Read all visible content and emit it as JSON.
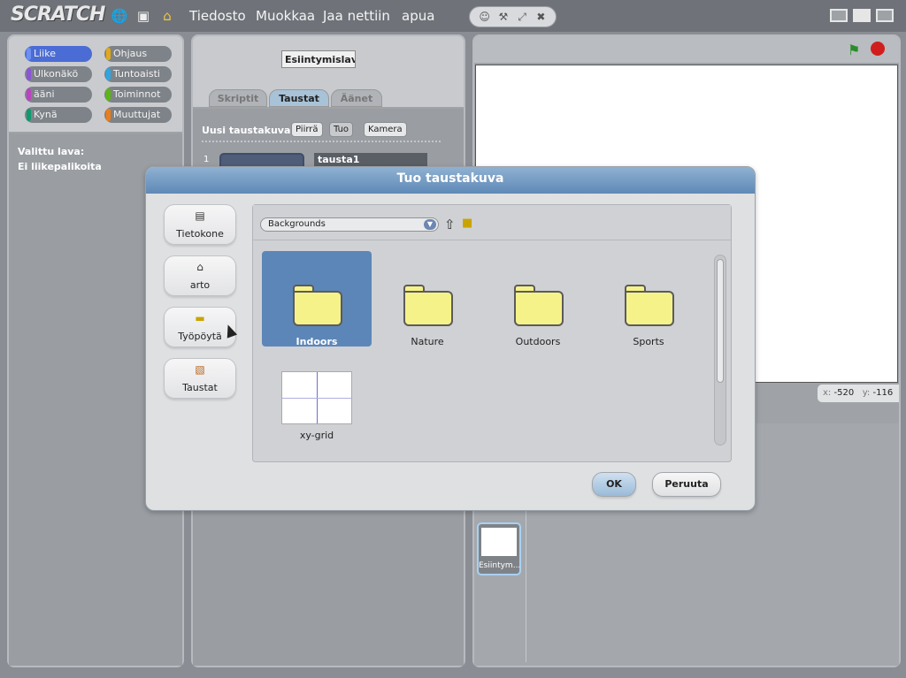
{
  "app": {
    "logo": "SCRATCH",
    "menu": [
      "Tiedosto",
      "Muokkaa",
      "Jaa nettiin",
      "apua"
    ],
    "icons": [
      "globe-icon",
      "save-icon",
      "share-icon"
    ],
    "mode_icons": [
      "user-icon",
      "wrench-icon",
      "grow-icon",
      "shrink-icon"
    ]
  },
  "categories": [
    {
      "label": "Liike",
      "color": "#4a6cd4",
      "selected": true
    },
    {
      "label": "Ohjaus",
      "color": "#e1a91a"
    },
    {
      "label": "Ulkonäkö",
      "color": "#8a55d7"
    },
    {
      "label": "Tuntoaisti",
      "color": "#2ca5e2"
    },
    {
      "label": "ääni",
      "color": "#bb42c3"
    },
    {
      "label": "Toiminnot",
      "color": "#5cb712"
    },
    {
      "label": "Kynä",
      "color": "#0e9a6c"
    },
    {
      "label": "Muuttujat",
      "color": "#ee7d16"
    }
  ],
  "blocks_panel": {
    "line1": "Valittu lava:",
    "line2": "Ei liikepalikoita"
  },
  "middle": {
    "stage_name": "Esiintymislava",
    "tabs": [
      "Skriptit",
      "Taustat",
      "Äänet"
    ],
    "active_tab": "Taustat",
    "new_bg_label": "Uusi taustakuva:",
    "buttons": [
      "Piirrä",
      "Tuo",
      "Kamera"
    ],
    "costume_num": "1",
    "costume_name": "tausta1"
  },
  "stage": {
    "coords_x_label": "x:",
    "coords_x": "-520",
    "coords_y_label": "y:",
    "coords_y": "-116",
    "stage_tile_label": "Esiintym..."
  },
  "dialog": {
    "title": "Tuo taustakuva",
    "locations": [
      {
        "label": "Tietokone",
        "icon": "computer-icon"
      },
      {
        "label": "arto",
        "icon": "home-icon"
      },
      {
        "label": "Työpöytä",
        "icon": "folder-icon"
      },
      {
        "label": "Taustat",
        "icon": "backgrounds-icon"
      }
    ],
    "path": "Backgrounds",
    "items": [
      {
        "name": "Indoors",
        "type": "folder",
        "selected": true
      },
      {
        "name": "Nature",
        "type": "folder"
      },
      {
        "name": "Outdoors",
        "type": "folder"
      },
      {
        "name": "Sports",
        "type": "folder"
      },
      {
        "name": "xy-grid",
        "type": "image"
      }
    ],
    "ok_label": "OK",
    "cancel_label": "Peruuta"
  }
}
